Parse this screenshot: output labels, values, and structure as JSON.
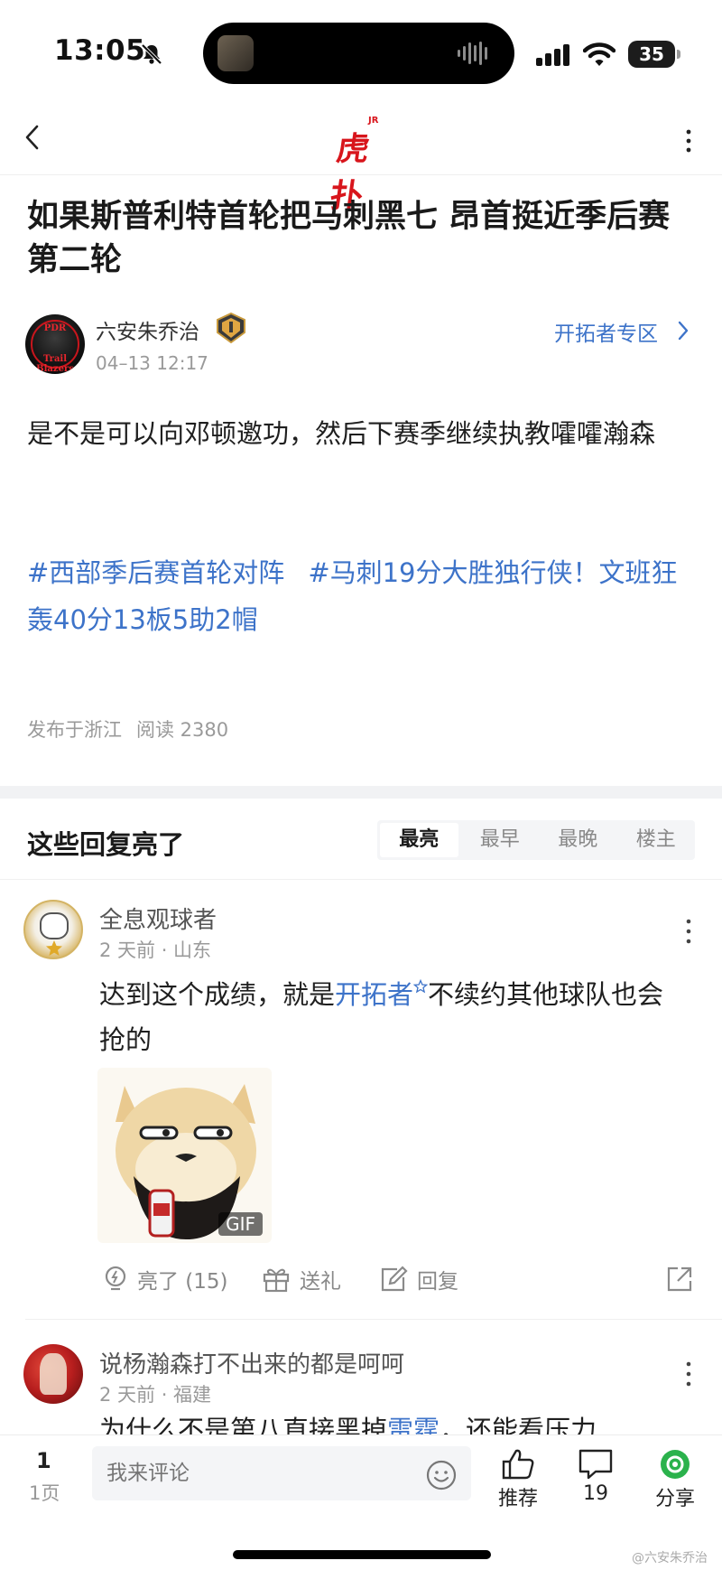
{
  "status_bar": {
    "time": "13:05",
    "battery": "35"
  },
  "nav": {
    "logo_main": "虎扑",
    "logo_sup": "JR"
  },
  "post": {
    "title": "如果斯普利特首轮把马刺黑七 昂首挺近季后赛第二轮",
    "author": "六安朱乔治",
    "time": "04–13 12:17",
    "zone_link": "开拓者专区",
    "body": "是不是可以向邓顿邀功，然后下赛季继续执教嚯嚯瀚森",
    "tags": [
      "#西部季后赛首轮对阵",
      "#马刺19分大胜独行侠！文班狂轰40分13板5助2帽"
    ],
    "location": "发布于浙江",
    "reads": "阅读 2380"
  },
  "replies_section": {
    "title": "这些回复亮了",
    "sort_tabs": [
      "最亮",
      "最早",
      "最晚",
      "楼主"
    ],
    "active_tab": "最亮"
  },
  "replies": [
    {
      "name": "全息观球者",
      "meta": "2 天前 · 山东",
      "text_before": "达到这个成绩，就是",
      "link": "开拓者",
      "text_after": "不续约其他球队也会抢的",
      "gif_label": "GIF",
      "light": "亮了 (15)",
      "gift": "送礼",
      "reply": "回复"
    },
    {
      "name": "说杨瀚森打不出来的都是呵呵",
      "meta": "2 天前 · 福建",
      "text_before": "为什么不是第八直接黑掉",
      "link": "雷霆",
      "text_after": "，还能看压力"
    }
  ],
  "bottom_bar": {
    "page_num": "1",
    "page_label": "1页",
    "comment_placeholder": "我来评论",
    "recommend": "推荐",
    "comments": "19",
    "share": "分享"
  },
  "watermark": "@六安朱乔治",
  "colors": {
    "accent_blue": "#3d73c9",
    "logo_red": "#d8151c",
    "share_green": "#2bb24c"
  }
}
